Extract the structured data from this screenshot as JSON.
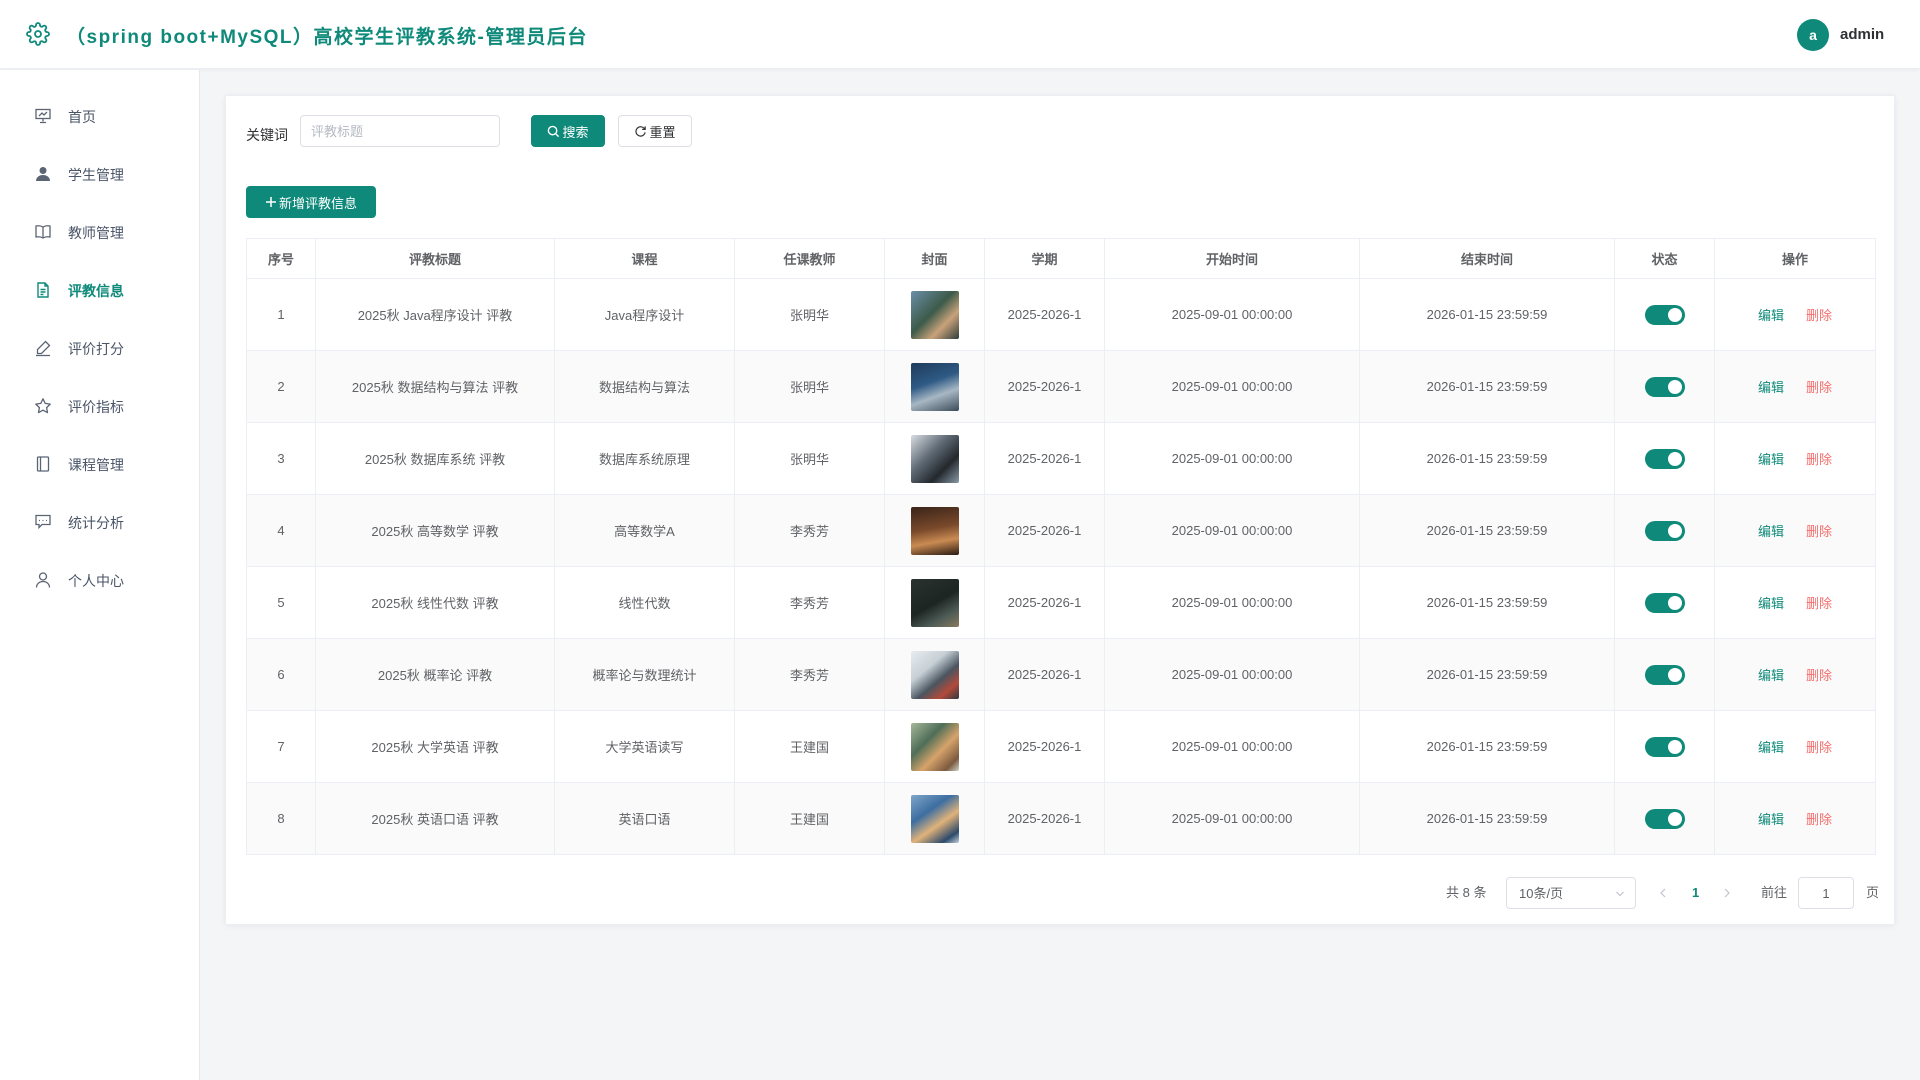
{
  "header": {
    "title": "（spring boot+MySQL）高校学生评教系统-管理员后台",
    "avatar_initial": "a",
    "username": "admin"
  },
  "sidebar": {
    "items": [
      {
        "label": "首页",
        "icon": "presentation-board-icon",
        "active": false
      },
      {
        "label": "学生管理",
        "icon": "user-solid-icon",
        "active": false
      },
      {
        "label": "教师管理",
        "icon": "open-book-icon",
        "active": false
      },
      {
        "label": "评教信息",
        "icon": "document-icon",
        "active": true
      },
      {
        "label": "评价打分",
        "icon": "pen-edit-icon",
        "active": false
      },
      {
        "label": "评价指标",
        "icon": "star-icon",
        "active": false
      },
      {
        "label": "课程管理",
        "icon": "notebook-icon",
        "active": false
      },
      {
        "label": "统计分析",
        "icon": "chat-board-icon",
        "active": false
      },
      {
        "label": "个人中心",
        "icon": "user-outline-icon",
        "active": false
      }
    ]
  },
  "search": {
    "label": "关键词",
    "placeholder": "评教标题",
    "value": "",
    "search_button": "搜索",
    "reset_button": "重置"
  },
  "toolbar": {
    "add_button": "新增评教信息"
  },
  "table": {
    "columns": [
      "序号",
      "评教标题",
      "课程",
      "任课教师",
      "封面",
      "学期",
      "开始时间",
      "结束时间",
      "状态",
      "操作"
    ],
    "edit_label": "编辑",
    "delete_label": "删除",
    "rows": [
      {
        "no": "1",
        "title": "2025秋 Java程序设计 评教",
        "course": "Java程序设计",
        "teacher": "张明华",
        "term": "2025-2026-1",
        "start": "2025-09-01 00:00:00",
        "end": "2026-01-15 23:59:59",
        "enabled": true
      },
      {
        "no": "2",
        "title": "2025秋 数据结构与算法 评教",
        "course": "数据结构与算法",
        "teacher": "张明华",
        "term": "2025-2026-1",
        "start": "2025-09-01 00:00:00",
        "end": "2026-01-15 23:59:59",
        "enabled": true
      },
      {
        "no": "3",
        "title": "2025秋 数据库系统 评教",
        "course": "数据库系统原理",
        "teacher": "张明华",
        "term": "2025-2026-1",
        "start": "2025-09-01 00:00:00",
        "end": "2026-01-15 23:59:59",
        "enabled": true
      },
      {
        "no": "4",
        "title": "2025秋 高等数学 评教",
        "course": "高等数学A",
        "teacher": "李秀芳",
        "term": "2025-2026-1",
        "start": "2025-09-01 00:00:00",
        "end": "2026-01-15 23:59:59",
        "enabled": true
      },
      {
        "no": "5",
        "title": "2025秋 线性代数 评教",
        "course": "线性代数",
        "teacher": "李秀芳",
        "term": "2025-2026-1",
        "start": "2025-09-01 00:00:00",
        "end": "2026-01-15 23:59:59",
        "enabled": true
      },
      {
        "no": "6",
        "title": "2025秋 概率论 评教",
        "course": "概率论与数理统计",
        "teacher": "李秀芳",
        "term": "2025-2026-1",
        "start": "2025-09-01 00:00:00",
        "end": "2026-01-15 23:59:59",
        "enabled": true
      },
      {
        "no": "7",
        "title": "2025秋 大学英语 评教",
        "course": "大学英语读写",
        "teacher": "王建国",
        "term": "2025-2026-1",
        "start": "2025-09-01 00:00:00",
        "end": "2026-01-15 23:59:59",
        "enabled": true
      },
      {
        "no": "8",
        "title": "2025秋 英语口语 评教",
        "course": "英语口语",
        "teacher": "王建国",
        "term": "2025-2026-1",
        "start": "2025-09-01 00:00:00",
        "end": "2026-01-15 23:59:59",
        "enabled": true
      }
    ]
  },
  "pagination": {
    "total": "共 8 条",
    "page_size": "10条/页",
    "current_page": "1",
    "goto_label": "前往",
    "goto_value": "1",
    "page_unit": "页"
  },
  "colors": {
    "primary": "#0f8a7a",
    "danger": "#f56c6c",
    "background": "#f4f5f7"
  }
}
